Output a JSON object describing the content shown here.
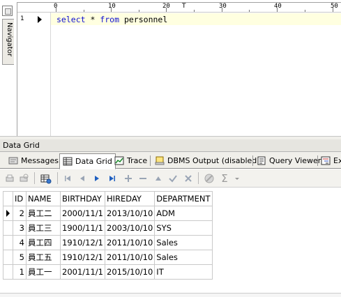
{
  "navigator": {
    "label": "Navigator"
  },
  "editor": {
    "ruler": [
      "0",
      "10",
      "20",
      "30",
      "40",
      "50"
    ],
    "line_number": "1",
    "code": {
      "kw1": "select",
      "mid1": " * ",
      "kw2": "from",
      "rest": " personnel"
    }
  },
  "panel": {
    "title": "Data Grid"
  },
  "tabs": [
    {
      "label": "Messages"
    },
    {
      "label": "Data Grid"
    },
    {
      "label": "Trace"
    },
    {
      "label": "DBMS Output (disabled)"
    },
    {
      "label": "Query Viewer"
    },
    {
      "label": "Ex"
    }
  ],
  "grid": {
    "columns": [
      "ID",
      "NAME",
      "BIRTHDAY",
      "HIREDAY",
      "DEPARTMENT"
    ],
    "rows": [
      [
        "2",
        "員工二",
        "2000/11/1",
        "2013/10/10",
        "ADM"
      ],
      [
        "3",
        "員工三",
        "1900/11/1",
        "2003/10/10",
        "SYS"
      ],
      [
        "4",
        "員工四",
        "1910/12/1",
        "2011/10/10",
        "Sales"
      ],
      [
        "5",
        "員工五",
        "1910/12/1",
        "2011/10/10",
        "Sales"
      ],
      [
        "1",
        "員工一",
        "2001/11/1",
        "2015/10/10",
        "IT"
      ]
    ]
  },
  "colors": {
    "keyword": "#1010d0",
    "current_line": "#ffffe0",
    "nav_blue": "#2060c0"
  }
}
